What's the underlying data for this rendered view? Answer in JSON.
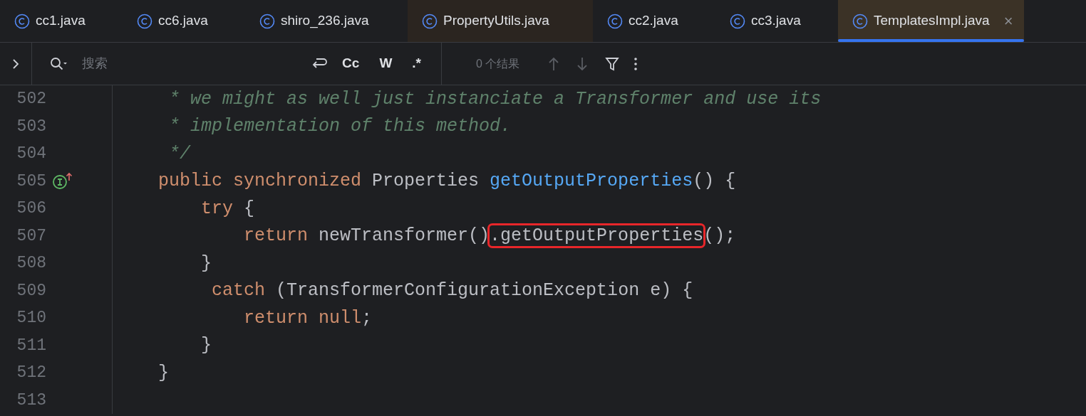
{
  "tabs": [
    {
      "label": "cc1.java",
      "selected": false,
      "tinted": false
    },
    {
      "label": "cc6.java",
      "selected": false,
      "tinted": false
    },
    {
      "label": "shiro_236.java",
      "selected": false,
      "tinted": false
    },
    {
      "label": "PropertyUtils.java",
      "selected": false,
      "tinted": true
    },
    {
      "label": "cc2.java",
      "selected": false,
      "tinted": false
    },
    {
      "label": "cc3.java",
      "selected": false,
      "tinted": false
    },
    {
      "label": "TemplatesImpl.java",
      "selected": true,
      "tinted": true,
      "close": "×"
    }
  ],
  "search": {
    "placeholder": "搜索",
    "options": [
      "Cc",
      "W",
      ".*"
    ],
    "results": "0 个结果"
  },
  "lines": [
    {
      "number": "502",
      "tokens": [
        {
          "kind": "comment",
          "text": "     * we might as well just instanciate a Transformer and use its"
        }
      ]
    },
    {
      "number": "503",
      "tokens": [
        {
          "kind": "comment",
          "text": "     * implementation of this method."
        }
      ]
    },
    {
      "number": "504",
      "tokens": [
        {
          "kind": "comment",
          "text": "     */"
        }
      ]
    },
    {
      "number": "505",
      "marker": true,
      "tokens": [
        {
          "kind": "keyword",
          "text": "    public synchronized "
        },
        {
          "kind": "plain",
          "text": "Properties "
        },
        {
          "kind": "method",
          "text": "getOutputProperties"
        },
        {
          "kind": "plain",
          "text": "() {"
        }
      ]
    },
    {
      "number": "506",
      "tokens": [
        {
          "kind": "keyword",
          "text": "        try "
        },
        {
          "kind": "plain",
          "text": "{"
        }
      ]
    },
    {
      "number": "507",
      "tokens": [
        {
          "kind": "keyword",
          "text": "            return "
        },
        {
          "kind": "plain",
          "text": "newTransformer()"
        },
        {
          "kind": "boxed",
          "text": ".getOutputProperties"
        },
        {
          "kind": "plain",
          "text": "();"
        }
      ]
    },
    {
      "number": "508",
      "tokens": [
        {
          "kind": "plain",
          "text": "        }"
        }
      ]
    },
    {
      "number": "509",
      "tokens": [
        {
          "kind": "keyword",
          "text": "         catch "
        },
        {
          "kind": "plain",
          "text": "(TransformerConfigurationException e) {"
        }
      ]
    },
    {
      "number": "510",
      "tokens": [
        {
          "kind": "keyword",
          "text": "            return null"
        },
        {
          "kind": "plain",
          "text": ";"
        }
      ]
    },
    {
      "number": "511",
      "tokens": [
        {
          "kind": "plain",
          "text": "        }"
        }
      ]
    },
    {
      "number": "512",
      "tokens": [
        {
          "kind": "plain",
          "text": "    }"
        }
      ]
    },
    {
      "number": "513"
    }
  ]
}
